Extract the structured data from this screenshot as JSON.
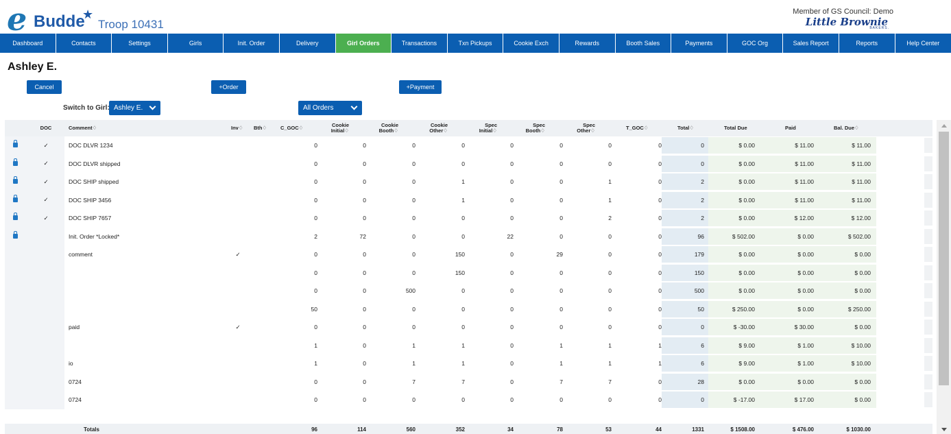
{
  "header": {
    "logo_e": "e",
    "logo_budde": "Budde",
    "troop": "Troop 10431",
    "member": "Member of GS Council: Demo",
    "baker_logo": "Little Brownie",
    "baker_sub": "BAKERS."
  },
  "nav": [
    {
      "label": "Dashboard",
      "active": false
    },
    {
      "label": "Contacts",
      "active": false
    },
    {
      "label": "Settings",
      "active": false
    },
    {
      "label": "Girls",
      "active": false
    },
    {
      "label": "Init. Order",
      "active": false
    },
    {
      "label": "Delivery",
      "active": false
    },
    {
      "label": "Girl Orders",
      "active": true
    },
    {
      "label": "Transactions",
      "active": false
    },
    {
      "label": "Txn Pickups",
      "active": false
    },
    {
      "label": "Cookie Exch",
      "active": false
    },
    {
      "label": "Rewards",
      "active": false
    },
    {
      "label": "Booth Sales",
      "active": false
    },
    {
      "label": "Payments",
      "active": false
    },
    {
      "label": "GOC Org",
      "active": false
    },
    {
      "label": "Sales Report",
      "active": false
    },
    {
      "label": "Reports",
      "active": false
    },
    {
      "label": "Help Center",
      "active": false
    }
  ],
  "girl_name": "Ashley E.",
  "buttons": {
    "cancel": "Cancel",
    "order": "+Order",
    "payment": "+Payment"
  },
  "switch": {
    "label": "Switch to Girl:",
    "girl": "Ashley E.",
    "filter": "All Orders"
  },
  "columns": {
    "doc": "DOC",
    "comment": "Comment♢",
    "inv": "Inv♢",
    "bth": "Bth♢",
    "c_goc": "C_GOC♢",
    "cookie_initial": "Cookie Initial♢",
    "cookie_booth": "Cookie Booth♢",
    "cookie_other": "Cookie Other♢",
    "spec_initial": "Spec Initial♢",
    "spec_booth": "Spec Booth♢",
    "spec_other": "Spec Other♢",
    "t_goc": "T_GOC♢",
    "total": "Total♢",
    "total_due": "Total Due",
    "paid": "Paid",
    "bal_due": "Bal. Due♢"
  },
  "rows": [
    {
      "locked": true,
      "doc": "✓",
      "comment": "DOC DLVR 1234",
      "inv": "",
      "bth": "",
      "c_goc": "0",
      "ci": "0",
      "cb": "0",
      "co": "0",
      "si": "0",
      "sb": "0",
      "so": "0",
      "t_goc": "0",
      "total": "0",
      "total_due": "$ 0.00",
      "paid": "$ 11.00",
      "bal_due": "$ 11.00"
    },
    {
      "locked": true,
      "doc": "✓",
      "comment": "DOC DLVR shipped",
      "inv": "",
      "bth": "",
      "c_goc": "0",
      "ci": "0",
      "cb": "0",
      "co": "0",
      "si": "0",
      "sb": "0",
      "so": "0",
      "t_goc": "0",
      "total": "0",
      "total_due": "$ 0.00",
      "paid": "$ 11.00",
      "bal_due": "$ 11.00"
    },
    {
      "locked": true,
      "doc": "✓",
      "comment": "DOC SHIP shipped",
      "inv": "",
      "bth": "",
      "c_goc": "0",
      "ci": "0",
      "cb": "0",
      "co": "1",
      "si": "0",
      "sb": "0",
      "so": "1",
      "t_goc": "0",
      "total": "2",
      "total_due": "$ 0.00",
      "paid": "$ 11.00",
      "bal_due": "$ 11.00"
    },
    {
      "locked": true,
      "doc": "✓",
      "comment": "DOC SHIP 3456",
      "inv": "",
      "bth": "",
      "c_goc": "0",
      "ci": "0",
      "cb": "0",
      "co": "1",
      "si": "0",
      "sb": "0",
      "so": "1",
      "t_goc": "0",
      "total": "2",
      "total_due": "$ 0.00",
      "paid": "$ 11.00",
      "bal_due": "$ 11.00"
    },
    {
      "locked": true,
      "doc": "✓",
      "comment": "DOC SHIP 7657",
      "inv": "",
      "bth": "",
      "c_goc": "0",
      "ci": "0",
      "cb": "0",
      "co": "0",
      "si": "0",
      "sb": "0",
      "so": "2",
      "t_goc": "0",
      "total": "2",
      "total_due": "$ 0.00",
      "paid": "$ 12.00",
      "bal_due": "$ 12.00"
    },
    {
      "locked": true,
      "doc": "",
      "comment": "Init. Order *Locked*",
      "inv": "",
      "bth": "",
      "c_goc": "2",
      "ci": "72",
      "cb": "0",
      "co": "0",
      "si": "22",
      "sb": "0",
      "so": "0",
      "t_goc": "0",
      "total": "96",
      "total_due": "$ 502.00",
      "paid": "$ 0.00",
      "bal_due": "$ 502.00"
    },
    {
      "locked": false,
      "doc": "",
      "comment": "comment",
      "inv": "✓",
      "bth": "",
      "c_goc": "0",
      "ci": "0",
      "cb": "0",
      "co": "150",
      "si": "0",
      "sb": "29",
      "so": "0",
      "t_goc": "0",
      "total": "179",
      "total_due": "$ 0.00",
      "paid": "$ 0.00",
      "bal_due": "$ 0.00"
    },
    {
      "locked": false,
      "doc": "",
      "comment": "",
      "inv": "",
      "bth": "",
      "c_goc": "0",
      "ci": "0",
      "cb": "0",
      "co": "150",
      "si": "0",
      "sb": "0",
      "so": "0",
      "t_goc": "0",
      "total": "150",
      "total_due": "$ 0.00",
      "paid": "$ 0.00",
      "bal_due": "$ 0.00"
    },
    {
      "locked": false,
      "doc": "",
      "comment": "",
      "inv": "",
      "bth": "",
      "c_goc": "0",
      "ci": "0",
      "cb": "500",
      "co": "0",
      "si": "0",
      "sb": "0",
      "so": "0",
      "t_goc": "0",
      "total": "500",
      "total_due": "$ 0.00",
      "paid": "$ 0.00",
      "bal_due": "$ 0.00"
    },
    {
      "locked": false,
      "doc": "",
      "comment": "",
      "inv": "",
      "bth": "",
      "c_goc": "50",
      "ci": "0",
      "cb": "0",
      "co": "0",
      "si": "0",
      "sb": "0",
      "so": "0",
      "t_goc": "0",
      "total": "50",
      "total_due": "$ 250.00",
      "paid": "$ 0.00",
      "bal_due": "$ 250.00"
    },
    {
      "locked": false,
      "doc": "",
      "comment": "paid",
      "inv": "✓",
      "bth": "",
      "c_goc": "0",
      "ci": "0",
      "cb": "0",
      "co": "0",
      "si": "0",
      "sb": "0",
      "so": "0",
      "t_goc": "0",
      "total": "0",
      "total_due": "$ -30.00",
      "paid": "$ 30.00",
      "bal_due": "$ 0.00"
    },
    {
      "locked": false,
      "doc": "",
      "comment": "",
      "inv": "",
      "bth": "",
      "c_goc": "1",
      "ci": "0",
      "cb": "1",
      "co": "1",
      "si": "0",
      "sb": "1",
      "so": "1",
      "t_goc": "1",
      "total": "6",
      "total_due": "$ 9.00",
      "paid": "$ 1.00",
      "bal_due": "$ 10.00"
    },
    {
      "locked": false,
      "doc": "",
      "comment": "io",
      "inv": "",
      "bth": "",
      "c_goc": "1",
      "ci": "0",
      "cb": "1",
      "co": "1",
      "si": "0",
      "sb": "1",
      "so": "1",
      "t_goc": "1",
      "total": "6",
      "total_due": "$ 9.00",
      "paid": "$ 1.00",
      "bal_due": "$ 10.00"
    },
    {
      "locked": false,
      "doc": "",
      "comment": "0724",
      "inv": "",
      "bth": "",
      "c_goc": "0",
      "ci": "0",
      "cb": "7",
      "co": "7",
      "si": "0",
      "sb": "7",
      "so": "7",
      "t_goc": "0",
      "total": "28",
      "total_due": "$ 0.00",
      "paid": "$ 0.00",
      "bal_due": "$ 0.00"
    },
    {
      "locked": false,
      "doc": "",
      "comment": "0724",
      "inv": "",
      "bth": "",
      "c_goc": "0",
      "ci": "0",
      "cb": "0",
      "co": "0",
      "si": "0",
      "sb": "0",
      "so": "0",
      "t_goc": "0",
      "total": "0",
      "total_due": "$ -17.00",
      "paid": "$ 17.00",
      "bal_due": "$ 0.00"
    }
  ],
  "totals": {
    "label": "Totals",
    "c_goc": "96",
    "ci": "114",
    "cb": "560",
    "co": "352",
    "si": "34",
    "sb": "78",
    "so": "53",
    "t_goc": "44",
    "total": "1331",
    "total_due": "$ 1508.00",
    "paid": "$ 476.00",
    "bal_due": "$ 1030.00"
  }
}
